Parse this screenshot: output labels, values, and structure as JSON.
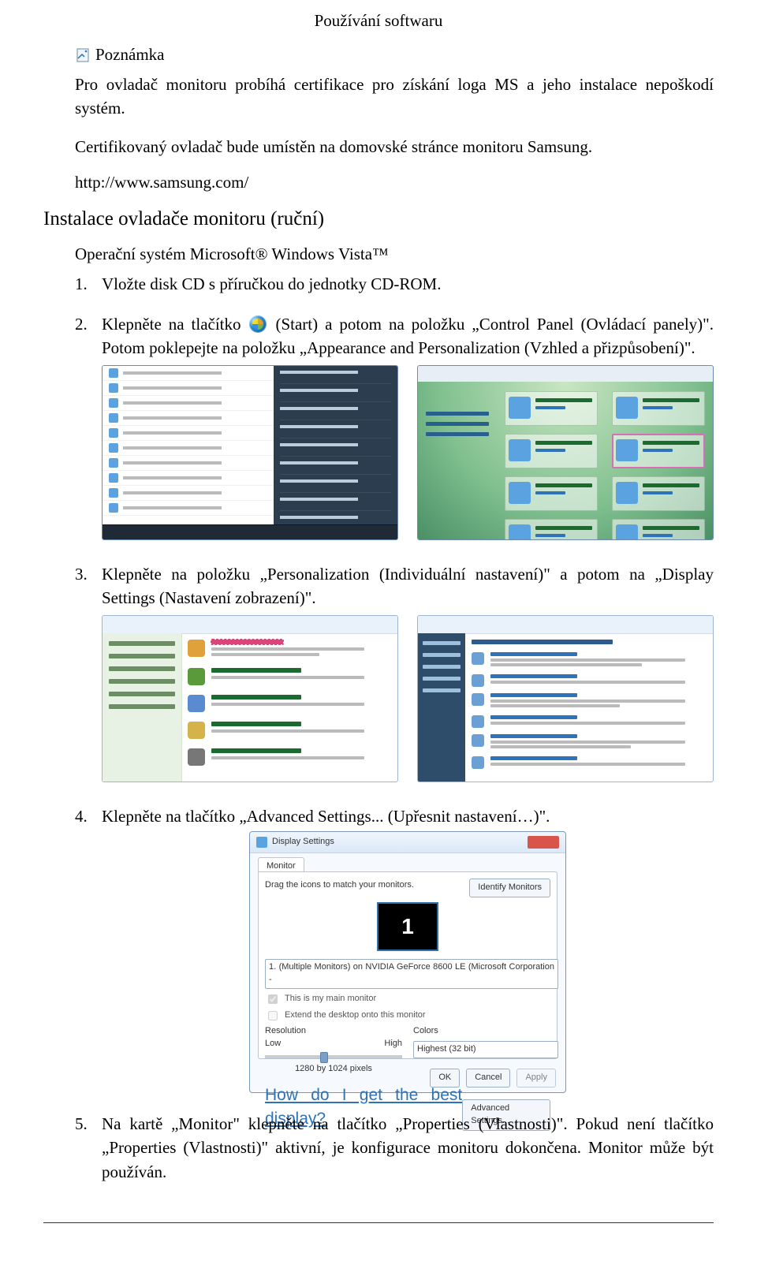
{
  "headerTitle": "Používání softwaru",
  "note": {
    "label": "Poznámka",
    "p1": "Pro ovladač monitoru probíhá certifikace pro získání loga MS a jeho instalace nepoškodí systém.",
    "p2": "Certifikovaný ovladač bude umístěn na domovské stránce monitoru Samsung.",
    "url": "http://www.samsung.com/"
  },
  "section": {
    "h2": "Instalace ovladače monitoru (ruční)",
    "sub": "Operační systém Microsoft® Windows Vista™"
  },
  "steps": {
    "s1": "Vložte disk CD s příručkou do jednotky CD-ROM.",
    "s2a": "Klepněte na tlačítko ",
    "s2b": "(Start) a potom na položku „Control Panel (Ovládací panely)\". Potom poklepejte na položku „Appearance and Personalization (Vzhled a přizpůsobení)\".",
    "s3": "Klepněte na položku „Personalization (Individuální nastavení)\" a potom na „Display Settings (Nastavení zobrazení)\".",
    "s4": "Klepněte na tlačítko „Advanced Settings... (Upřesnit nastavení…)\".",
    "s5": "Na kartě „Monitor\" klepněte na tlačítko „Properties (Vlastnosti)\". Pokud není tlačítko „Properties (Vlastnosti)\" aktivní, je konfigurace monitoru dokončena. Monitor může být používán."
  },
  "displaySettings": {
    "title": "Display Settings",
    "tab": "Monitor",
    "hint": "Drag the icons to match your monitors.",
    "identify": "Identify Monitors",
    "monNum": "1",
    "device": "1. (Multiple Monitors) on NVIDIA GeForce 8600 LE (Microsoft Corporation - ",
    "chk1": "This is my main monitor",
    "chk2": "Extend the desktop onto this monitor",
    "resLabel": "Resolution",
    "colLabel": "Colors",
    "low": "Low",
    "high": "High",
    "resVal": "1280 by 1024 pixels",
    "colVal": "Highest (32 bit)",
    "help": "How do I get the best display?",
    "adv": "Advanced Settings...",
    "ok": "OK",
    "cancel": "Cancel",
    "apply": "Apply"
  }
}
